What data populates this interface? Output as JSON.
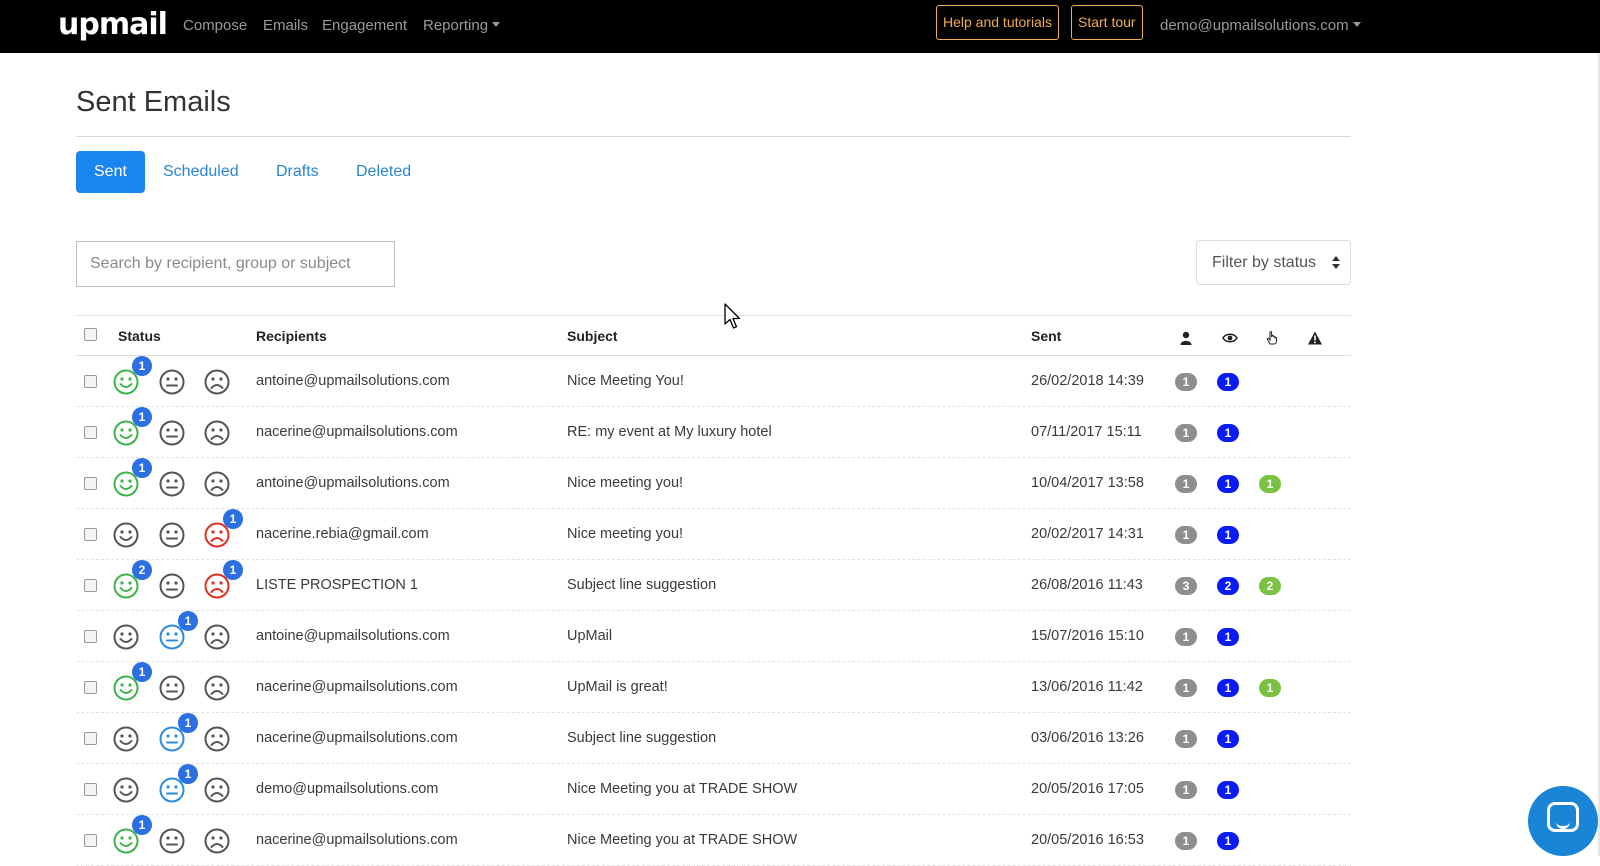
{
  "nav": {
    "logo": "upmail",
    "compose": "Compose",
    "emails": "Emails",
    "engagement": "Engagement",
    "reporting": "Reporting",
    "help": "Help and tutorials",
    "tour": "Start tour",
    "user": "demo@upmailsolutions.com"
  },
  "page": {
    "title": "Sent Emails"
  },
  "tabs": [
    {
      "label": "Sent"
    },
    {
      "label": "Scheduled"
    },
    {
      "label": "Drafts"
    },
    {
      "label": "Deleted"
    }
  ],
  "search": {
    "placeholder": "Search by recipient, group or subject"
  },
  "filter": {
    "label": "Filter by status"
  },
  "table": {
    "headers": {
      "status": "Status",
      "recipients": "Recipients",
      "subject": "Subject",
      "sent": "Sent"
    },
    "header_icons": [
      "person-icon",
      "eye-icon",
      "pointer-hand-icon",
      "warning-icon"
    ],
    "rows": [
      {
        "happy": "1",
        "neutral": "",
        "sad": "",
        "recipient": "antoine@upmailsolutions.com",
        "subject": "Nice Meeting You!",
        "sent": "26/02/2018 14:39",
        "recipients_count": "1",
        "opens": "1",
        "clicks": ""
      },
      {
        "happy": "1",
        "neutral": "",
        "sad": "",
        "recipient": "nacerine@upmailsolutions.com",
        "subject": "RE: my event at My luxury hotel",
        "sent": "07/11/2017 15:11",
        "recipients_count": "1",
        "opens": "1",
        "clicks": ""
      },
      {
        "happy": "1",
        "neutral": "",
        "sad": "",
        "recipient": "antoine@upmailsolutions.com",
        "subject": "Nice meeting you!",
        "sent": "10/04/2017 13:58",
        "recipients_count": "1",
        "opens": "1",
        "clicks": "1"
      },
      {
        "happy": "",
        "neutral": "",
        "sad": "1",
        "recipient": "nacerine.rebia@gmail.com",
        "subject": "Nice meeting you!",
        "sent": "20/02/2017 14:31",
        "recipients_count": "1",
        "opens": "1",
        "clicks": ""
      },
      {
        "happy": "2",
        "neutral": "",
        "sad": "1",
        "recipient": "LISTE PROSPECTION 1",
        "subject": "Subject line suggestion",
        "sent": "26/08/2016 11:43",
        "recipients_count": "3",
        "opens": "2",
        "clicks": "2"
      },
      {
        "happy": "",
        "neutral": "1",
        "sad": "",
        "recipient": "antoine@upmailsolutions.com",
        "subject": "UpMail",
        "sent": "15/07/2016 15:10",
        "recipients_count": "1",
        "opens": "1",
        "clicks": ""
      },
      {
        "happy": "1",
        "neutral": "",
        "sad": "",
        "recipient": "nacerine@upmailsolutions.com",
        "subject": "UpMail is great!",
        "sent": "13/06/2016 11:42",
        "recipients_count": "1",
        "opens": "1",
        "clicks": "1"
      },
      {
        "happy": "",
        "neutral": "1",
        "sad": "",
        "recipient": "nacerine@upmailsolutions.com",
        "subject": "Subject line suggestion",
        "sent": "03/06/2016 13:26",
        "recipients_count": "1",
        "opens": "1",
        "clicks": ""
      },
      {
        "happy": "",
        "neutral": "1",
        "sad": "",
        "recipient": "demo@upmailsolutions.com",
        "subject": "Nice Meeting you at TRADE SHOW",
        "sent": "20/05/2016 17:05",
        "recipients_count": "1",
        "opens": "1",
        "clicks": ""
      },
      {
        "happy": "1",
        "neutral": "",
        "sad": "",
        "recipient": "nacerine@upmailsolutions.com",
        "subject": "Nice Meeting you at TRADE SHOW",
        "sent": "20/05/2016 16:53",
        "recipients_count": "1",
        "opens": "1",
        "clicks": ""
      }
    ]
  },
  "colors": {
    "happy": "#3bb54a",
    "neutral_active": "#2b8be0",
    "sad_active": "#e0301e",
    "inactive_face": "#555555",
    "count_badge": "#2b6fe0",
    "recipients_badge": "#8e8e8e",
    "opens_badge": "#0a1cf5",
    "clicks_badge": "#7cc242",
    "primary": "#1a85f0",
    "nav_outline": "#f0ad4e"
  },
  "chat": {
    "icon": "chat-bubble-icon"
  }
}
